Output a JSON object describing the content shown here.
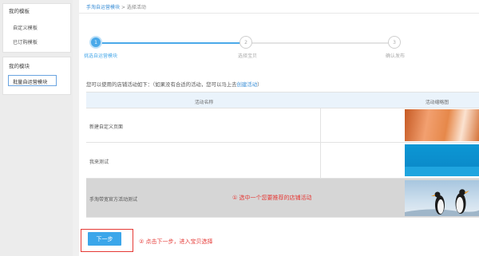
{
  "sidebar": {
    "section1": {
      "title": "我的模板",
      "items": [
        {
          "label": "自定义模板"
        },
        {
          "label": "已订购模板"
        }
      ]
    },
    "section2": {
      "title": "我的模块",
      "items": [
        {
          "label": "批量自运营模块"
        }
      ]
    }
  },
  "breadcrumb": {
    "link": "手淘自运营模块",
    "separator": ">",
    "current": "选择活动"
  },
  "steps": [
    {
      "number": "1",
      "label": "挑选自运营模块",
      "state": "active"
    },
    {
      "number": "2",
      "label": "选择宝贝",
      "state": "idle"
    },
    {
      "number": "3",
      "label": "确认发布",
      "state": "idle"
    }
  ],
  "intro": {
    "text": "您可以使用的店铺活动如下：（如果没有合适的活动，您可以马上去",
    "link": "创建活动",
    "suffix": "）"
  },
  "table": {
    "headers": {
      "name": "活动名称",
      "image": "活动缩略图"
    },
    "rows": [
      {
        "name": "新建自定义页面",
        "thumb": "orange-abstract"
      },
      {
        "name": "我来测试",
        "thumb": "blue-banner"
      },
      {
        "name": "手淘带宽官方活动测试",
        "thumb": "penguins-photo",
        "selected": true
      }
    ]
  },
  "annotations": {
    "select": "①  选中一个您要推荐的店铺活动",
    "next": "②  点击下一步，进入宝贝选择"
  },
  "buttons": {
    "next": "下一步"
  },
  "colors": {
    "accent": "#4aa9e9",
    "annotation": "#e53935",
    "link": "#3a8ed6",
    "selected_row": "#d6d6d6"
  }
}
